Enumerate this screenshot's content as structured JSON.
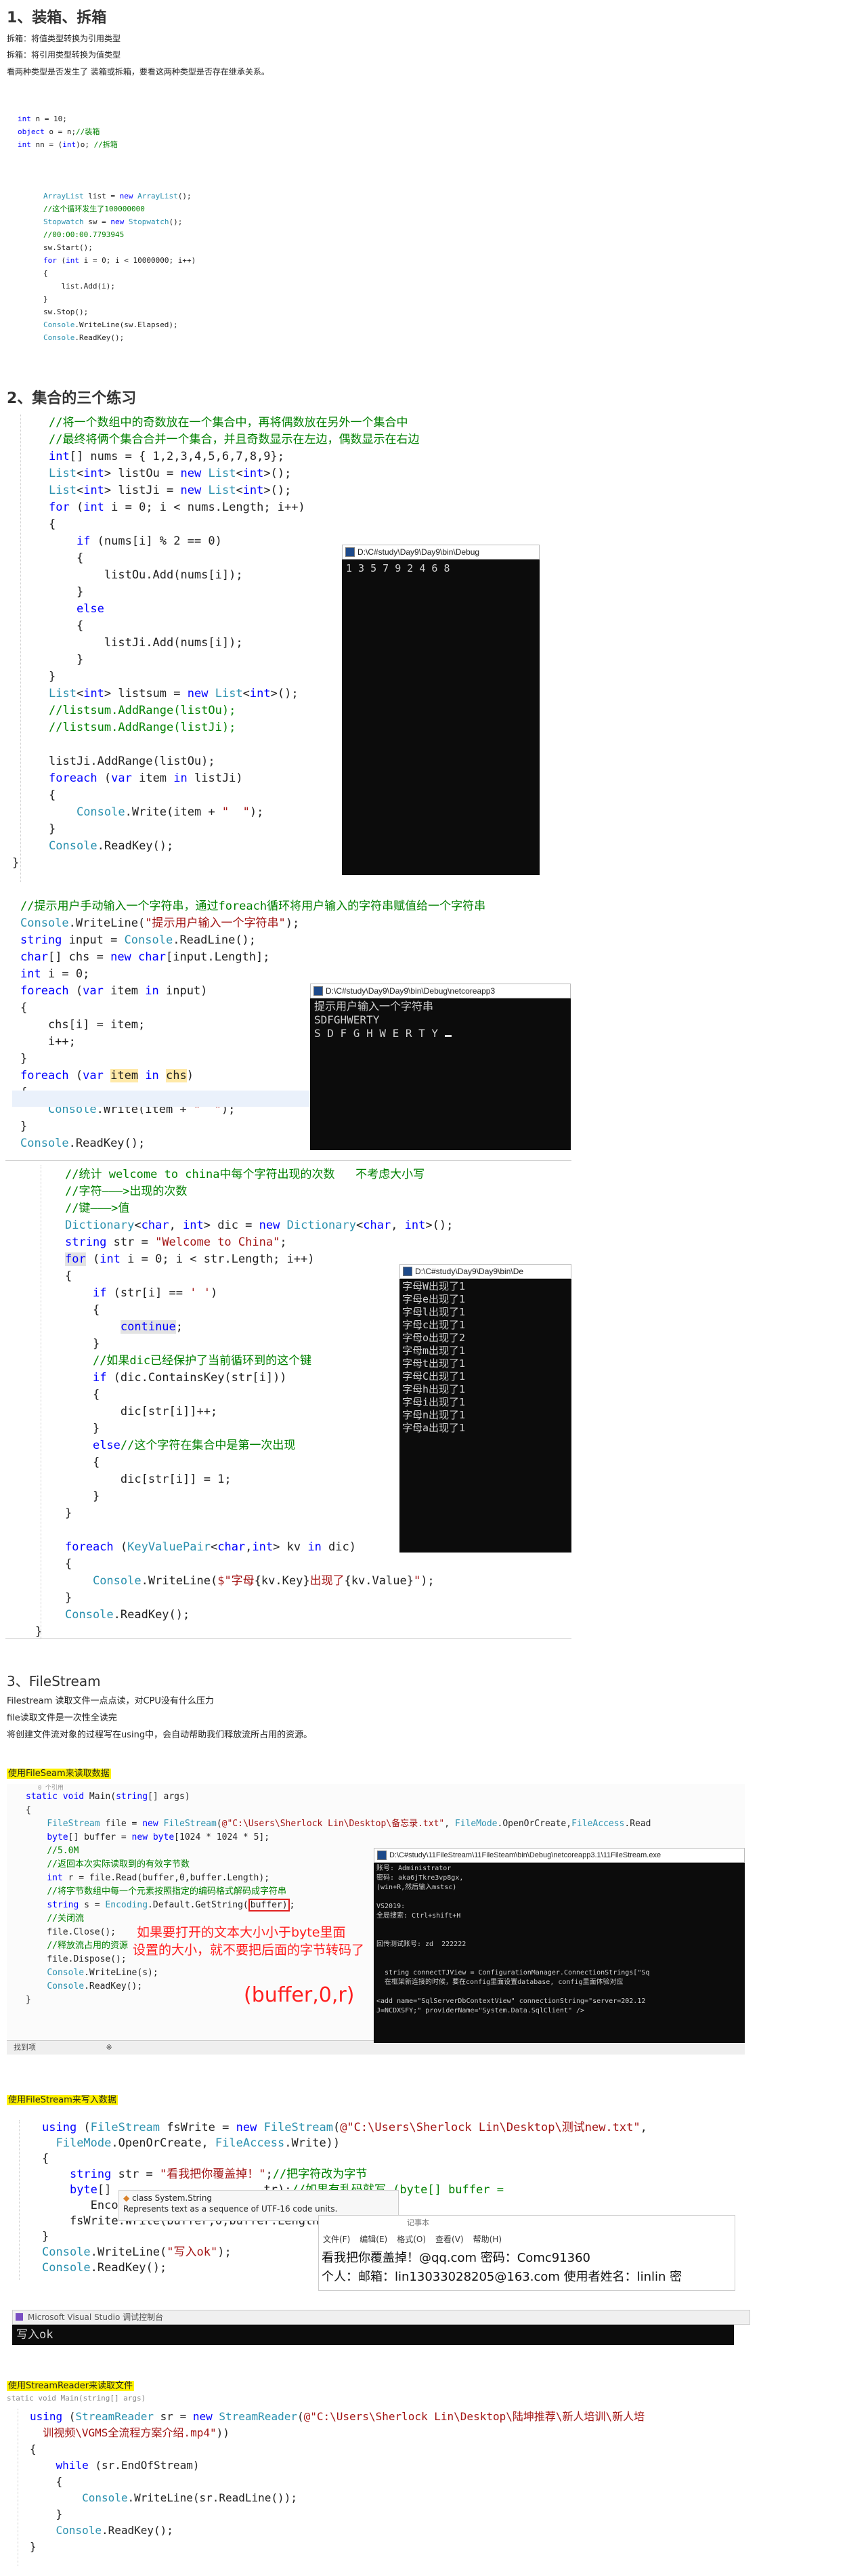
{
  "s1": {
    "title": "1、装箱、拆箱",
    "l1": "拆箱：将值类型转换为引用类型",
    "l2": "拆箱：将引用类型转换为值类型",
    "l3": "看两种类型是否发生了 装箱或拆箱，要看这两种类型是否存在继承关系。"
  },
  "s2": {
    "title": "2、集合的三个练习"
  },
  "s3": {
    "title": "3、FileStream",
    "l1": "Filestream 读取文件一点点读，对CPU没有什么压力",
    "l2": "file读取文件是一次性全读完",
    "l3": "将创建文件流对象的过程写在using中，会自动帮助我们释放流所占用的资源。"
  },
  "h_read": "使用FileSeam来读取数据",
  "h_write": "使用FileStream来写入数据",
  "h_reader": "使用StreamReader来读取文件",
  "console1": {
    "title": "D:\\C#study\\Day9\\Day9\\bin\\Debug",
    "out": "1 3 5 7 9 2 4 6 8"
  },
  "console2": {
    "title": "D:\\C#study\\Day9\\Day9\\bin\\Debug\\netcoreapp3",
    "l1": "提示用户输入一个字符串",
    "l2": "SDFGHWERTY",
    "l3": "S D F G H W E R T Y "
  },
  "console3": {
    "title": "D:\\C#study\\Day9\\Day9\\bin\\De",
    "rows": [
      "字母W出现了1",
      "字母e出现了1",
      "字母l出现了1",
      "字母c出现了1",
      "字母o出现了2",
      "字母m出现了1",
      "字母t出现了1",
      "字母C出现了1",
      "字母h出现了1",
      "字母i出现了1",
      "字母n出现了1",
      "字母a出现了1"
    ]
  },
  "console4": {
    "title": "D:\\C#study\\11FileStream\\11FileSteam\\bin\\Debug\\netcoreapp3.1\\11FileStream.exe",
    "rows": [
      "账号: Administrator",
      "密码: aka6jTkre3vp8gx,",
      "(win+R,然后输入mstsc)",
      "",
      "VS2019:",
      "全局搜索: Ctrl+shift+H",
      "",
      "",
      "回传测试账号: zd  222222",
      "",
      "",
      "  string connectTJView = ConfigurationManager.ConnectionStrings[\"Sq",
      "  在框架新连接的时候，要在config里面设置database, config里面体验对应",
      "",
      "<add name=\"SqlServerDbContextView\" connectionString=\"server=202.12",
      "J=NCDXSFY;\" providerName=\"System.Data.SqlClient\" />"
    ]
  },
  "anno1": "如果要打开的文本大小小于byte里面",
  "anno2": "设置的大小，就不要把后面的字节转码了",
  "anno3": "(buffer,0,r)",
  "tooltip": {
    "line1": "class System.String",
    "line2": "Represents text as a sequence of UTF-16 code units."
  },
  "notepad": {
    "partial": "记事本",
    "menu": [
      "文件(F)",
      "编辑(E)",
      "格式(O)",
      "查看(V)",
      "帮助(H)"
    ],
    "line1": "看我把你覆盖掉！@qq.com    密码：Comc91360",
    "line2": "个人：邮箱：lin13033028205@163.com    使用者姓名：linlin  密"
  },
  "vsconsole": {
    "title": "Microsoft Visual Studio 调试控制台",
    "out": "写入ok"
  },
  "statusbar": {
    "left": "找到项",
    "mid": "※"
  }
}
